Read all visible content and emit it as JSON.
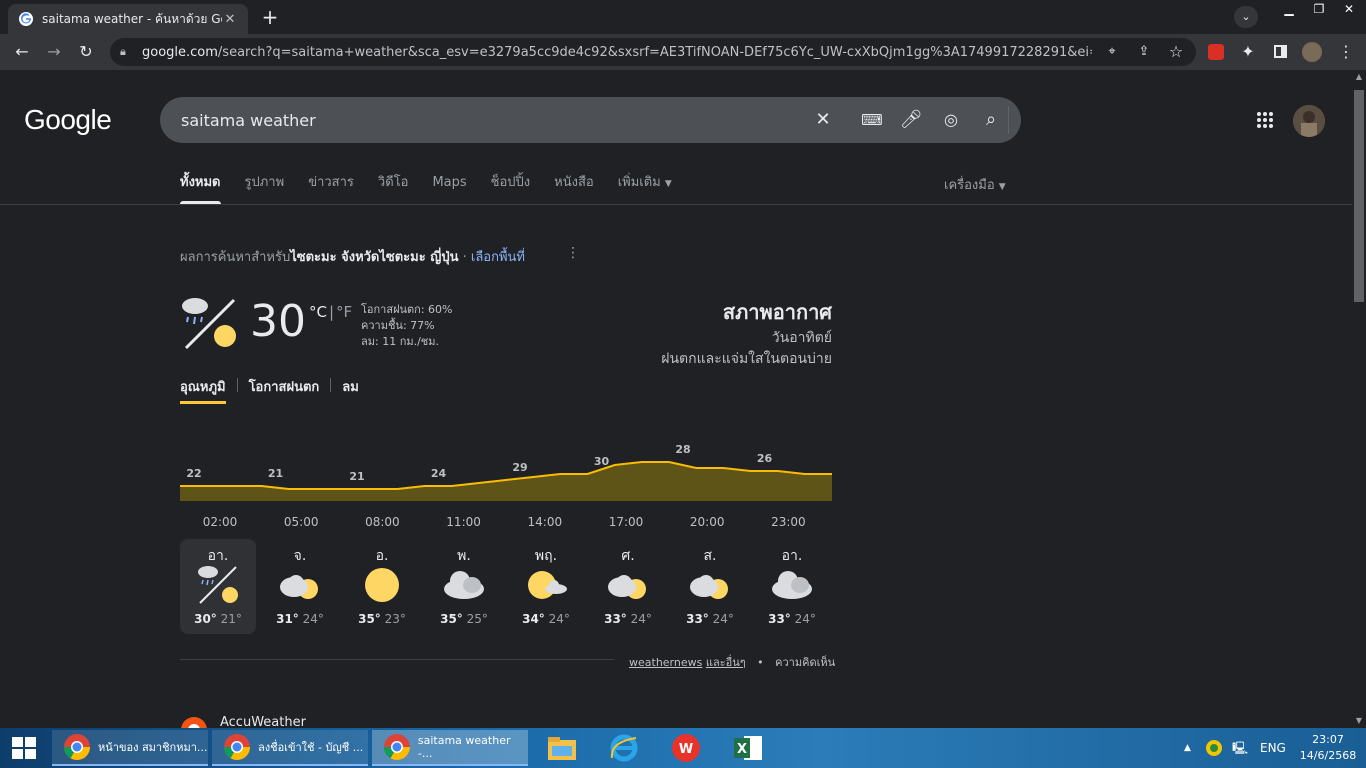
{
  "browser": {
    "tab_title": "saitama weather - ค้นหาด้วย Google",
    "url_host": "google.com",
    "url_path": "/search?q=saitama+weather&sca_esv=e3279a5cc9de4c92&sxsrf=AE3TifNOAN-DEf75c6Yc_UW-cxXbQjm1gg%3A1749917228291&ei=LJ5Na..."
  },
  "search": {
    "query": "saitama weather",
    "logo": "Google"
  },
  "nav": {
    "tabs": [
      "ทั้งหมด",
      "รูปภาพ",
      "ข่าวสาร",
      "วิดีโอ",
      "Maps",
      "ช็อปปิ้ง",
      "หนังสือ",
      "เพิ่มเติม"
    ],
    "tools": "เครื่องมือ"
  },
  "results_for": {
    "prefix": "ผลการค้นหาสำหรับ",
    "location": "ไซตะมะ จังหวัดไซตะมะ ญี่ปุ่น",
    "choose": "เลือกพื้นที่"
  },
  "weather": {
    "temp": "30",
    "unit_c": "°C",
    "unit_f": "°F",
    "precip": "โอกาสฝนตก: 60%",
    "humidity": "ความชื้น: 77%",
    "wind": "ลม: 11 กม./ชม.",
    "heading": "สภาพอากาศ",
    "day": "วันอาทิตย์",
    "desc": "ฝนตกและแจ่มใสในตอนบ่าย",
    "tabs": [
      "อุณหภูมิ",
      "โอกาสฝนตก",
      "ลม"
    ]
  },
  "chart_data": {
    "type": "area",
    "x": [
      "00:00",
      "01:00",
      "02:00",
      "03:00",
      "04:00",
      "05:00",
      "06:00",
      "07:00",
      "08:00",
      "09:00",
      "10:00",
      "11:00",
      "12:00",
      "13:00",
      "14:00",
      "15:00",
      "16:00",
      "17:00",
      "18:00",
      "19:00",
      "20:00",
      "21:00",
      "22:00",
      "23:00",
      "00:00"
    ],
    "values": [
      22,
      22,
      22,
      22,
      21,
      21,
      21,
      21,
      21,
      22,
      22,
      23,
      24,
      25,
      26,
      26,
      29,
      30,
      30,
      28,
      28,
      27,
      27,
      26,
      26
    ],
    "labels": [
      {
        "x": "00:00",
        "text": "22"
      },
      {
        "x": "03:00",
        "text": "21"
      },
      {
        "x": "06:00",
        "text": "21"
      },
      {
        "x": "09:00",
        "text": "24"
      },
      {
        "x": "12:00",
        "text": "29"
      },
      {
        "x": "15:00",
        "text": "30"
      },
      {
        "x": "18:00",
        "text": "28"
      },
      {
        "x": "21:00",
        "text": "26"
      }
    ],
    "hour_ticks": [
      "02:00",
      "05:00",
      "08:00",
      "11:00",
      "14:00",
      "17:00",
      "20:00",
      "23:00"
    ],
    "fill_color": "#5f5417",
    "line_color": "#fbbc04"
  },
  "forecast": [
    {
      "day": "อา.",
      "hi": "30°",
      "lo": "21°",
      "icon": "rain-and-sun-icon",
      "selected": true
    },
    {
      "day": "จ.",
      "hi": "31°",
      "lo": "24°",
      "icon": "cloudy-sun-icon"
    },
    {
      "day": "อ.",
      "hi": "35°",
      "lo": "23°",
      "icon": "sunny-icon"
    },
    {
      "day": "พ.",
      "hi": "35°",
      "lo": "25°",
      "icon": "cloudy-icon"
    },
    {
      "day": "พฤ.",
      "hi": "34°",
      "lo": "24°",
      "icon": "sun-cloud-icon"
    },
    {
      "day": "ศ.",
      "hi": "33°",
      "lo": "24°",
      "icon": "cloudy-sun-icon"
    },
    {
      "day": "ส.",
      "hi": "33°",
      "lo": "24°",
      "icon": "cloudy-sun-icon"
    },
    {
      "day": "อา.",
      "hi": "33°",
      "lo": "24°",
      "icon": "cloudy-icon"
    }
  ],
  "source": {
    "name": "weathernews",
    "more": "และอื่นๆ",
    "feedback": "ความคิดเห็น"
  },
  "next_result": "AccuWeather",
  "taskbar": {
    "items": [
      "หน้าของ สมาชิกหมา...",
      "ลงชื่อเข้าใช้ - บัญชี ...",
      "saitama weather -..."
    ],
    "lang": "ENG",
    "time": "23:07",
    "date": "14/6/2568"
  }
}
